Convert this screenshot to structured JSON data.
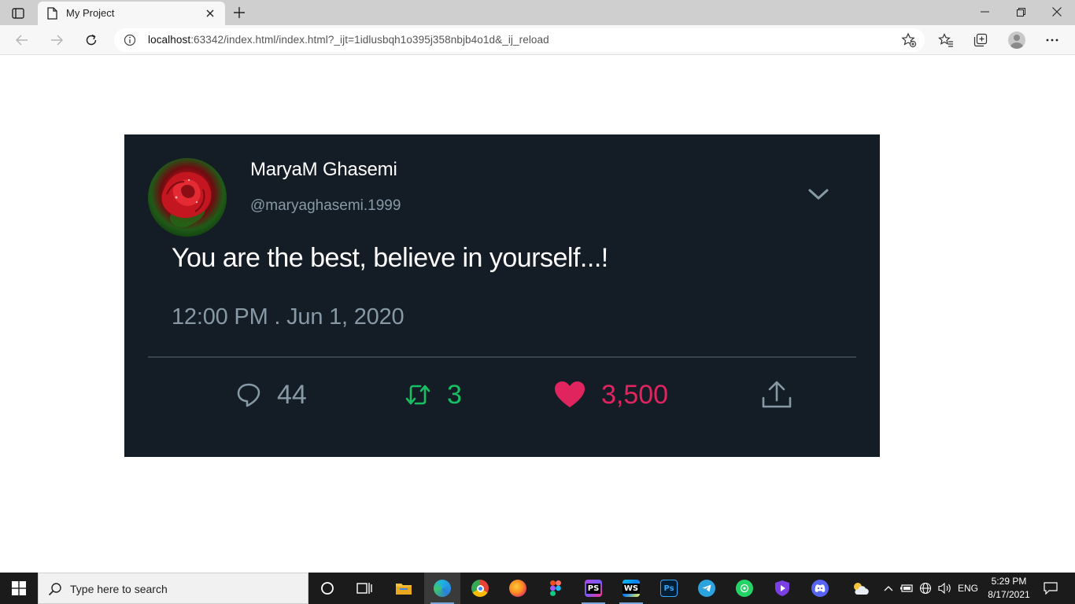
{
  "browser": {
    "tab_title": "My Project",
    "url_host": "localhost",
    "url_rest": ":63342/index.html/index.html?_ijt=1idlusbqh1o395j358nbjb4o1d&_ij_reload"
  },
  "tweet": {
    "display_name": "MaryaM Ghasemi",
    "handle": "@maryaghasemi.1999",
    "text": "You are the best, believe in yourself...!",
    "timestamp": "12:00 PM . Jun 1, 2020",
    "replies": "44",
    "retweets": "3",
    "likes": "3,500",
    "colors": {
      "background": "#141d26",
      "muted": "#8899a6",
      "retweet": "#17bf63",
      "like": "#e0245e"
    }
  },
  "taskbar": {
    "search_placeholder": "Type here to search",
    "language": "ENG",
    "time": "5:29 PM",
    "date": "8/17/2021",
    "apps": [
      "cortana-icon",
      "task-view-icon",
      "file-explorer-icon",
      "edge-icon",
      "chrome-icon",
      "firefox-icon",
      "figma-icon",
      "phpstorm-icon",
      "webstorm-icon",
      "photoshop-icon",
      "telegram-icon",
      "whatsapp-icon",
      "vpn-shield-icon",
      "discord-icon"
    ]
  }
}
